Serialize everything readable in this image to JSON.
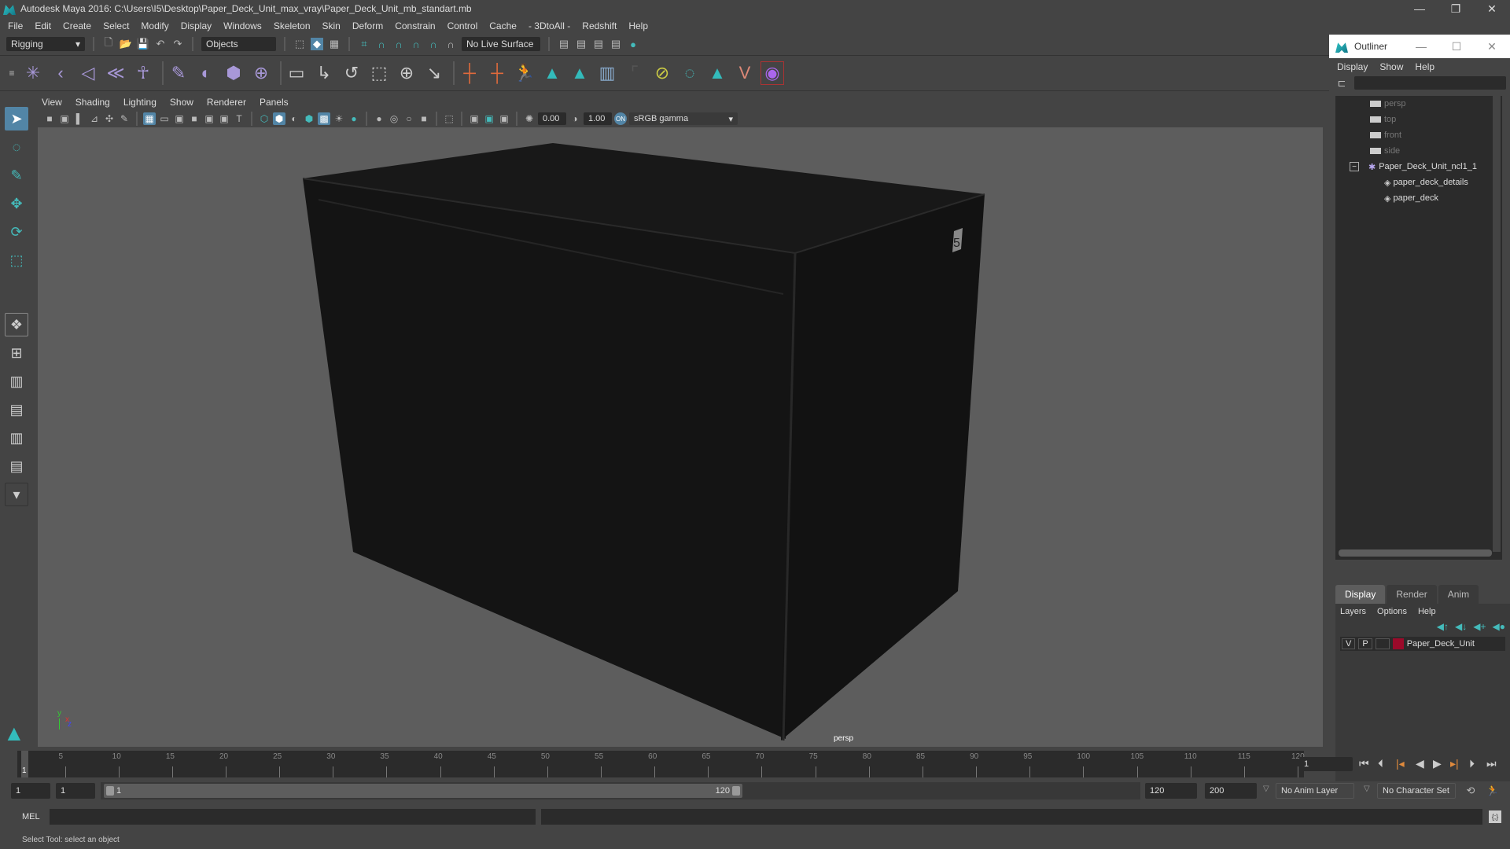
{
  "window": {
    "title": "Autodesk Maya 2016: C:\\Users\\I5\\Desktop\\Paper_Deck_Unit_max_vray\\Paper_Deck_Unit_mb_standart.mb",
    "minimize": "—",
    "restore": "❐",
    "close": "✕"
  },
  "menubar": [
    "File",
    "Edit",
    "Create",
    "Select",
    "Modify",
    "Display",
    "Windows",
    "Skeleton",
    "Skin",
    "Deform",
    "Constrain",
    "Control",
    "Cache",
    "- 3DtoAll -",
    "Redshift",
    "Help"
  ],
  "statusline": {
    "menuset": "Rigging",
    "selection_mode": "Objects",
    "live_surface": "No Live Surface"
  },
  "viewport": {
    "menu": [
      "View",
      "Shading",
      "Lighting",
      "Show",
      "Renderer",
      "Panels"
    ],
    "exposure": "0.00",
    "gamma": "1.00",
    "color_space": "sRGB gamma",
    "camera_label": "persp",
    "object_label": "5",
    "axis": {
      "x": "x",
      "y": "y",
      "z": "z"
    }
  },
  "outliner": {
    "title": "Outliner",
    "menu": [
      "Display",
      "Show",
      "Help"
    ],
    "items": [
      {
        "label": "persp",
        "type": "camera"
      },
      {
        "label": "top",
        "type": "camera"
      },
      {
        "label": "front",
        "type": "camera"
      },
      {
        "label": "side",
        "type": "camera"
      },
      {
        "label": "Paper_Deck_Unit_ncl1_1",
        "type": "group",
        "expanded": true
      },
      {
        "label": "paper_deck_details",
        "type": "mesh",
        "child": true
      },
      {
        "label": "paper_deck",
        "type": "mesh",
        "child": true
      }
    ]
  },
  "layer_editor": {
    "tabs": [
      "Display",
      "Render",
      "Anim"
    ],
    "active_tab": "Display",
    "menu": [
      "Layers",
      "Options",
      "Help"
    ],
    "layers": [
      {
        "v": "V",
        "p": "P",
        "name": "Paper_Deck_Unit",
        "color": "#9b0a2a"
      }
    ]
  },
  "timeline": {
    "ticks": [
      "5",
      "10",
      "15",
      "20",
      "25",
      "30",
      "35",
      "40",
      "45",
      "50",
      "55",
      "60",
      "65",
      "70",
      "75",
      "80",
      "85",
      "90",
      "95",
      "100",
      "105",
      "110",
      "115",
      "120"
    ],
    "current_frame_marker": "1",
    "current_frame": "1",
    "range_start": "1",
    "playback_start": "1",
    "slider_start": "1",
    "slider_end": "120",
    "playback_end": "120",
    "range_end": "200",
    "anim_layer": "No Anim Layer",
    "character_set": "No Character Set"
  },
  "cmdline": {
    "label": "MEL"
  },
  "helpline": {
    "text": "Select Tool: select an object"
  },
  "colors": {
    "accent": "#5285a6",
    "layer": "#9b0a2a",
    "viewport_bg": "#5d5d5d"
  }
}
